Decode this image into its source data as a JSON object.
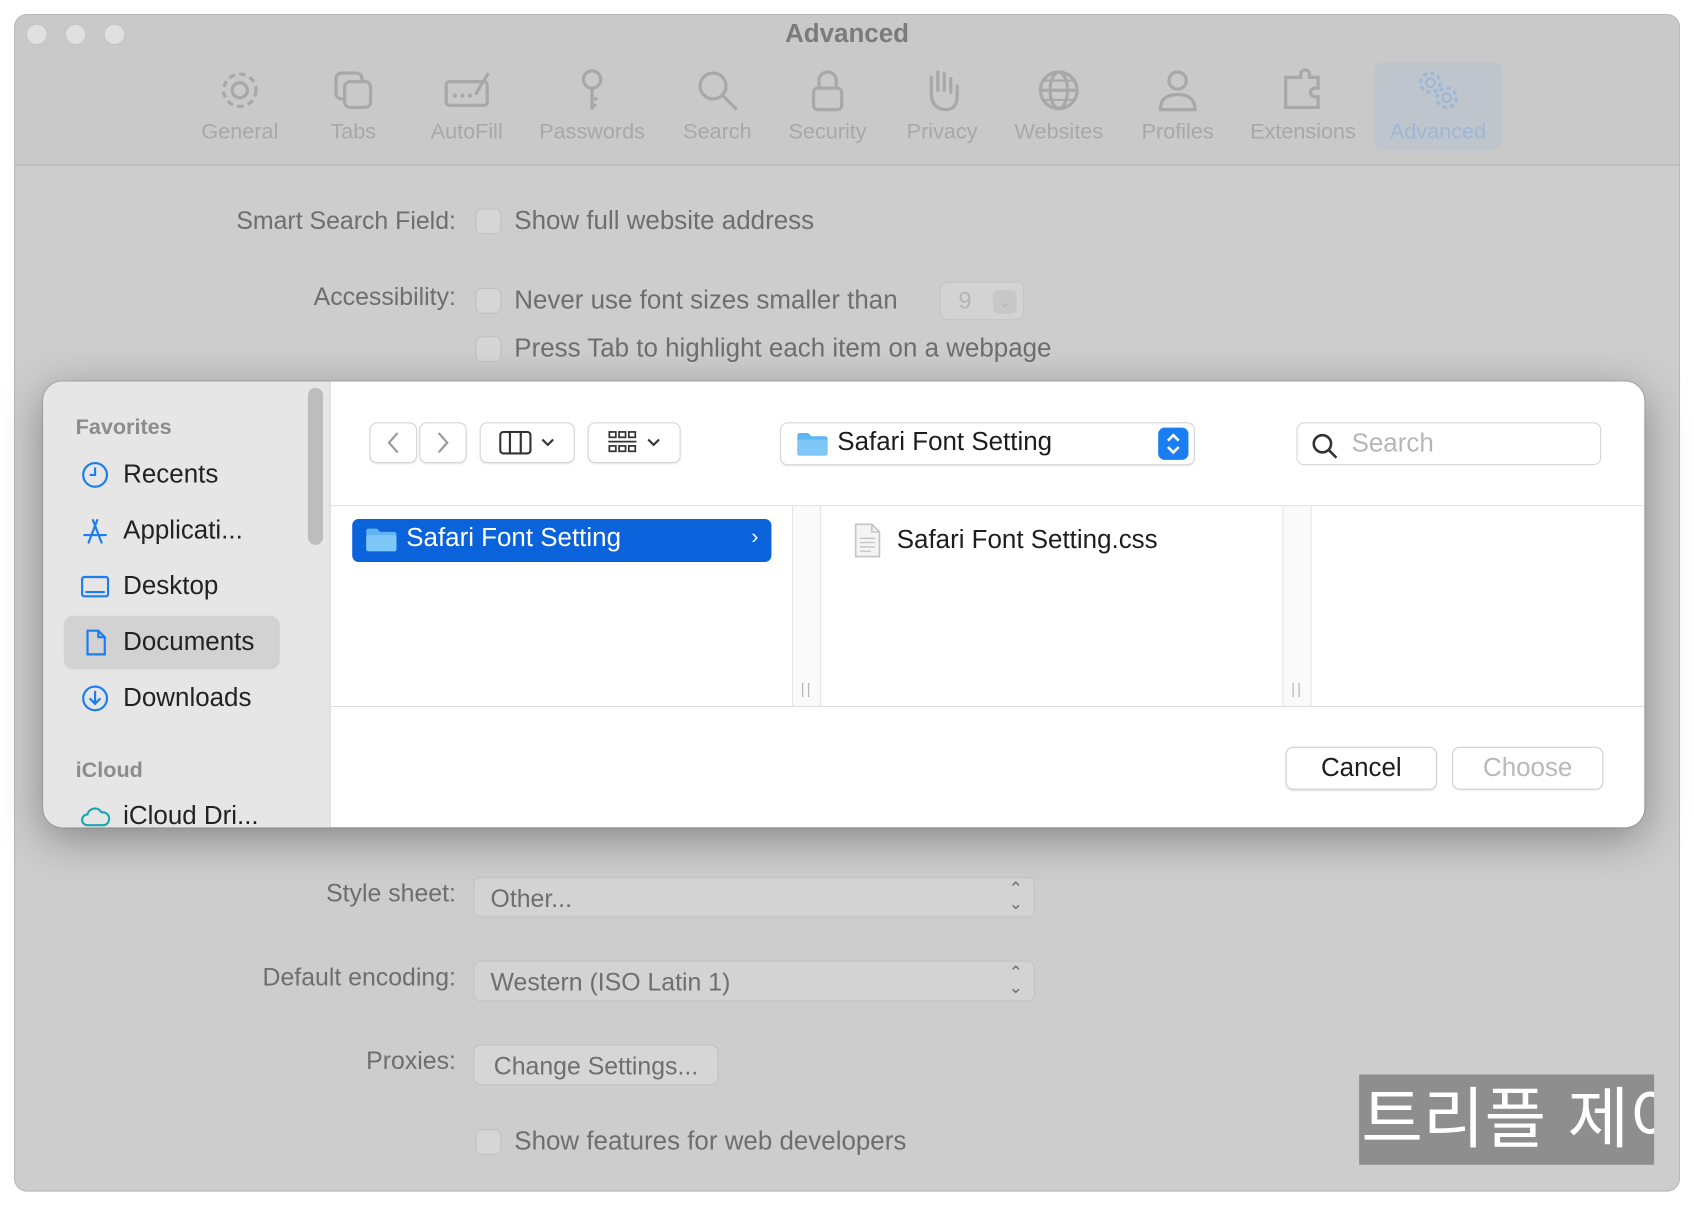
{
  "window": {
    "title": "Advanced"
  },
  "toolbar": {
    "items": [
      {
        "label": "General",
        "icon": "gear-icon"
      },
      {
        "label": "Tabs",
        "icon": "tabs-icon"
      },
      {
        "label": "AutoFill",
        "icon": "autofill-icon"
      },
      {
        "label": "Passwords",
        "icon": "key-icon"
      },
      {
        "label": "Search",
        "icon": "search-icon"
      },
      {
        "label": "Security",
        "icon": "lock-icon"
      },
      {
        "label": "Privacy",
        "icon": "hand-icon"
      },
      {
        "label": "Websites",
        "icon": "globe-icon"
      },
      {
        "label": "Profiles",
        "icon": "person-icon"
      },
      {
        "label": "Extensions",
        "icon": "puzzle-icon"
      },
      {
        "label": "Advanced",
        "icon": "gears-icon",
        "active": true
      }
    ]
  },
  "settings": {
    "smart_search_label": "Smart Search Field:",
    "smart_search_option": "Show full website address",
    "accessibility_label": "Accessibility:",
    "font_size_option": "Never use font sizes smaller than",
    "font_size_value": "9",
    "tab_highlight_option": "Press Tab to highlight each item on a webpage",
    "style_sheet_label": "Style sheet:",
    "style_sheet_value": "Other...",
    "encoding_label": "Default encoding:",
    "encoding_value": "Western (ISO Latin 1)",
    "proxies_label": "Proxies:",
    "proxies_button": "Change Settings...",
    "developer_option": "Show features for web developers"
  },
  "dialog": {
    "sidebar": {
      "favorites_header": "Favorites",
      "favorites": [
        {
          "label": "Recents",
          "icon": "clock-icon"
        },
        {
          "label": "Applicati...",
          "icon": "applications-icon"
        },
        {
          "label": "Desktop",
          "icon": "desktop-icon"
        },
        {
          "label": "Documents",
          "icon": "document-icon",
          "selected": true
        },
        {
          "label": "Downloads",
          "icon": "download-icon"
        }
      ],
      "icloud_header": "iCloud",
      "icloud": [
        {
          "label": "iCloud Dri...",
          "icon": "cloud-icon"
        }
      ]
    },
    "path_popup": "Safari Font Setting",
    "search_placeholder": "Search",
    "columns": {
      "col1_selected": "Safari Font Setting",
      "col2_file": "Safari Font Setting.css"
    },
    "cancel_button": "Cancel",
    "choose_button": "Choose"
  },
  "watermark": "트리플 제이",
  "colors": {
    "accent": "#0b63dc",
    "window_bg": "#cdcdcd",
    "sidebar_bg": "#e6e6e6"
  }
}
